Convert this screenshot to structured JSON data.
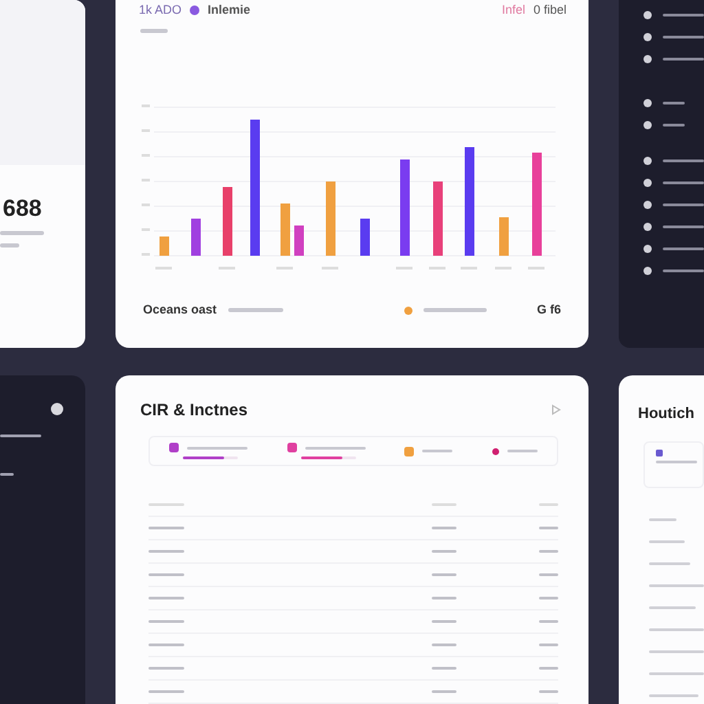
{
  "summary_card": {
    "value": "688"
  },
  "chart_card": {
    "title": "1k ADO",
    "legend": "Inlemie",
    "filter": "Infel",
    "count": "0 fibel",
    "footer_title": "Oceans oast",
    "footer_value": "G f6"
  },
  "table_card": {
    "title": "CIR & Inctnes",
    "stats": [
      {
        "color": "#b03fc8",
        "level": 0.75
      },
      {
        "color": "#e040a0",
        "level": 0.75
      },
      {
        "color": "#f0a040"
      },
      {
        "color": "#d02070"
      }
    ]
  },
  "notes_card": {
    "title": "Houtich"
  }
}
